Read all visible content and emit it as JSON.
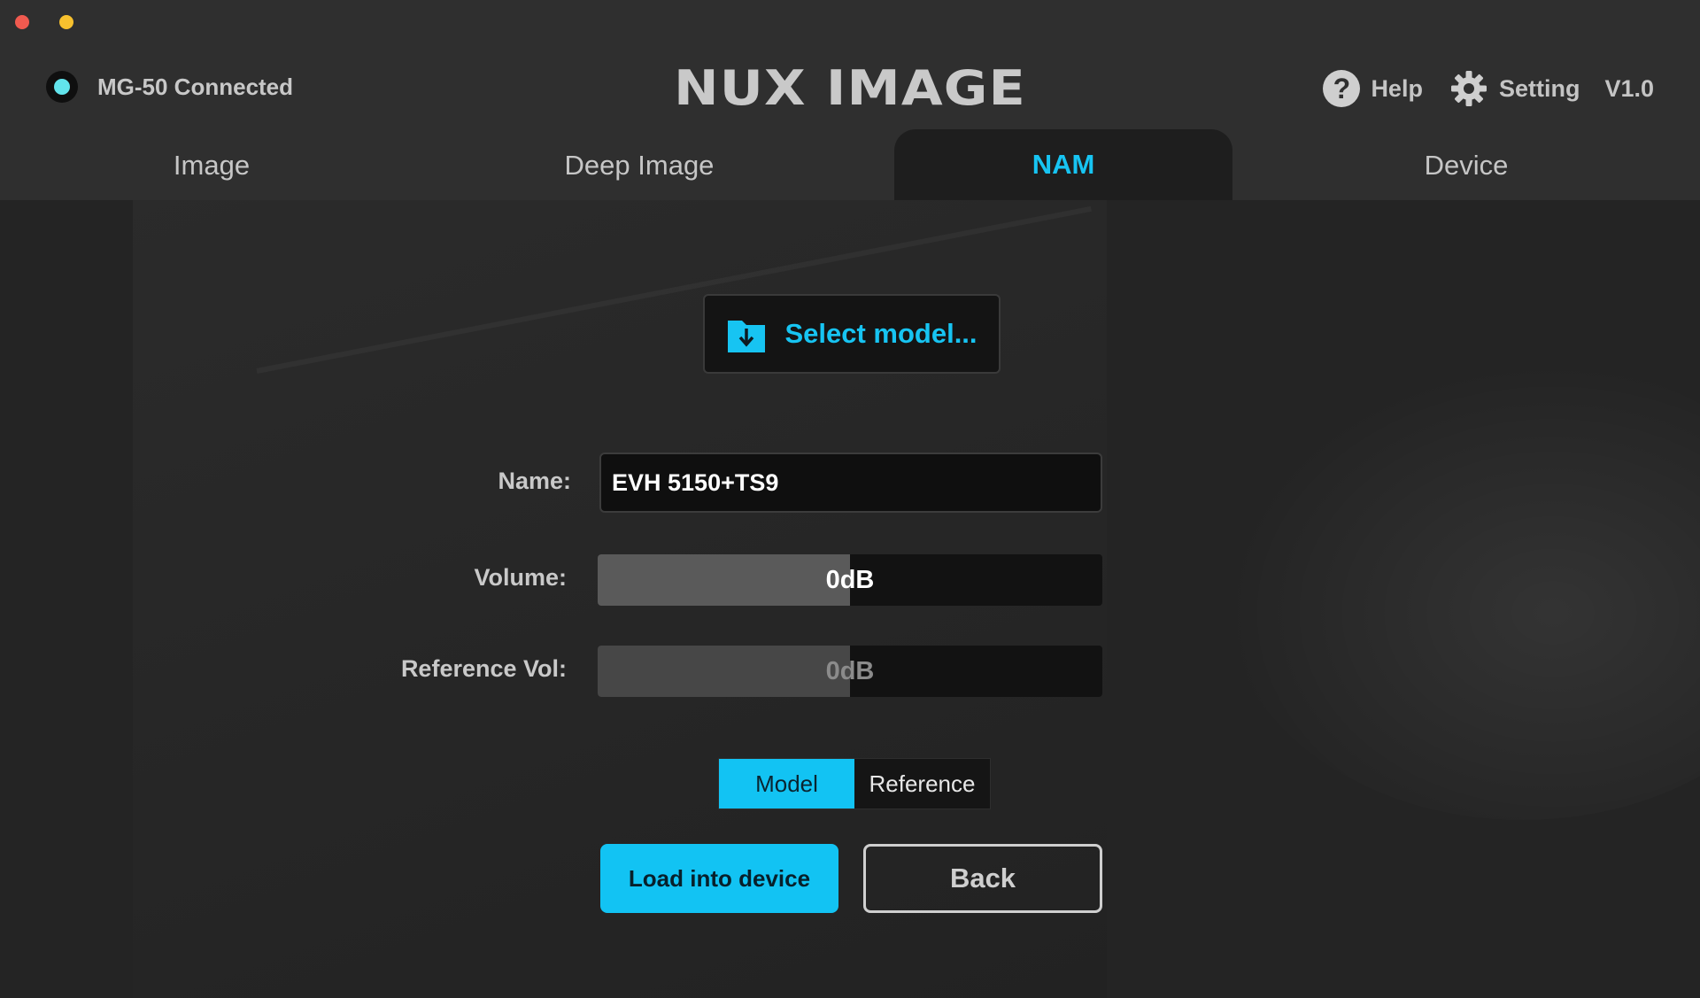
{
  "window_controls": {
    "close": "close",
    "minimize": "minimize"
  },
  "header": {
    "connection_status": "MG-50 Connected",
    "logo": "NUX IMAGE",
    "help_label": "Help",
    "setting_label": "Setting",
    "version": "V1.0"
  },
  "tabs": [
    {
      "label": "Image",
      "active": false
    },
    {
      "label": "Deep Image",
      "active": false
    },
    {
      "label": "NAM",
      "active": true
    },
    {
      "label": "Device",
      "active": false
    }
  ],
  "main": {
    "select_model_label": "Select model...",
    "name_label": "Name:",
    "name_value": "EVH 5150+TS9",
    "volume_label": "Volume:",
    "volume_value": "0dB",
    "volume_level": 0.5,
    "reference_label": "Reference Vol:",
    "reference_value": "0dB",
    "reference_level": 0.5,
    "segment": [
      {
        "label": "Model",
        "active": true
      },
      {
        "label": "Reference",
        "active": false
      }
    ],
    "load_button": "Load into device",
    "back_button": "Back"
  },
  "colors": {
    "accent": "#12c3f3",
    "connected_indicator": "#62e4ec",
    "background": "#242424"
  },
  "icons": [
    "help-icon",
    "gear-icon",
    "folder-download-icon"
  ]
}
